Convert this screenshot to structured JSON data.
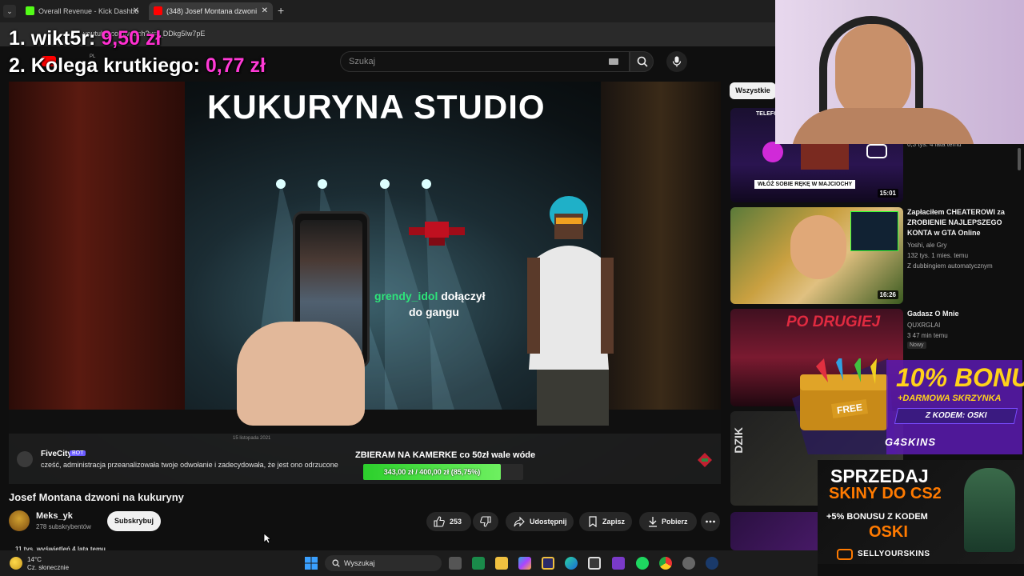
{
  "browser": {
    "tabs": [
      {
        "title": "Overall Revenue - Kick Dashbo",
        "color": "#53fc18"
      },
      {
        "title": "(348) Josef Montana dzwoni",
        "color": "#ff0000"
      }
    ],
    "new_tab": "+",
    "close": "✕",
    "url": "youtube.com/watch?v=I_DDkg5Iw7pE"
  },
  "overlay": {
    "line1_label": "1. wikt5r: ",
    "line1_amount": "9,50 zł",
    "line2_label": "2. Kolega krutkiego: ",
    "line2_amount": "0,77 zł"
  },
  "youtube": {
    "logo_suffix": "PL",
    "search_placeholder": "Szukaj"
  },
  "video": {
    "studio_title": "KUKURYNA STUDIO",
    "join_nick": "grendy_idol",
    "join_text": " dołączył",
    "join_text2": "do gangu",
    "chat": {
      "name": "FiveCity",
      "badge": "BOT",
      "message": "cześć, administracja przeanalizowała twoje odwołanie i zadecydowała, że jest ono odrzucone",
      "date": "15 listopada 2021"
    },
    "goal": {
      "title": "ZBIERAM NA KAMERKE co 50zł wale wóde",
      "text": "343,00 zł / 400,00 zł (85,75%)",
      "progress": 0.8575
    },
    "title": "Josef Montana dzwoni na kukuryny",
    "channel": {
      "name": "Meks_yk",
      "subs": "278 subskrybentów"
    },
    "subscribe": "Subskrybuj",
    "likes": "253",
    "share": "Udostępnij",
    "save": "Zapisz",
    "download": "Pobierz",
    "views": "11 tys. wyświetleń  4 lata temu"
  },
  "sidebar": {
    "chip_all": "Wszystkie",
    "items": [
      {
        "title": "",
        "meta": "0,3 tys.  4 lata temu",
        "duration": "15:01",
        "thumb_text": "WŁÓŻ SOBIE RĘKĘ W MAJCIOCHY",
        "thumb_head": "TELEFO"
      },
      {
        "title": "Zapłaciłem CHEATEROWI za ZROBIENIE NAJLEPSZEGO KONTA w GTA Online",
        "channel": "Yoshi, ale Gry",
        "meta": "132 tys.  1 mies. temu",
        "dub": "Z dubbingiem automatycznym",
        "duration": "16:26"
      },
      {
        "title": "Gadasz O Mnie",
        "channel": "QUXRGLAI",
        "meta": "3  47 min temu",
        "badge": "Nowy",
        "thumb_text": "PO DRUGIEJ"
      }
    ]
  },
  "ads": {
    "bonus_pct": "10% BONUS",
    "bonus_sub": "+DARMOWA SKRZYNKA",
    "bonus_code": "Z KODEM: OSKI",
    "bonus_free": "FREE",
    "bonus_brand": "G4SKINS",
    "sell_title": "SPRZEDAJ",
    "sell_sub": "SKINY DO CS2",
    "sell_bonus": "+5% BONUSU Z KODEM",
    "sell_code": "OSKI",
    "sell_brand": "SELLYOURSKINS",
    "side_text": "DZIK"
  },
  "taskbar": {
    "weather_temp": "14°C",
    "weather_desc": "Cz. słonecznie",
    "search": "Wyszukaj"
  },
  "colors": {
    "accent_pink": "#ff2fd0",
    "goal_green": "#2ccf2c",
    "join_green": "#2ee37a",
    "bonus_yellow": "#ffd21a",
    "sell_orange": "#ff7a00"
  }
}
